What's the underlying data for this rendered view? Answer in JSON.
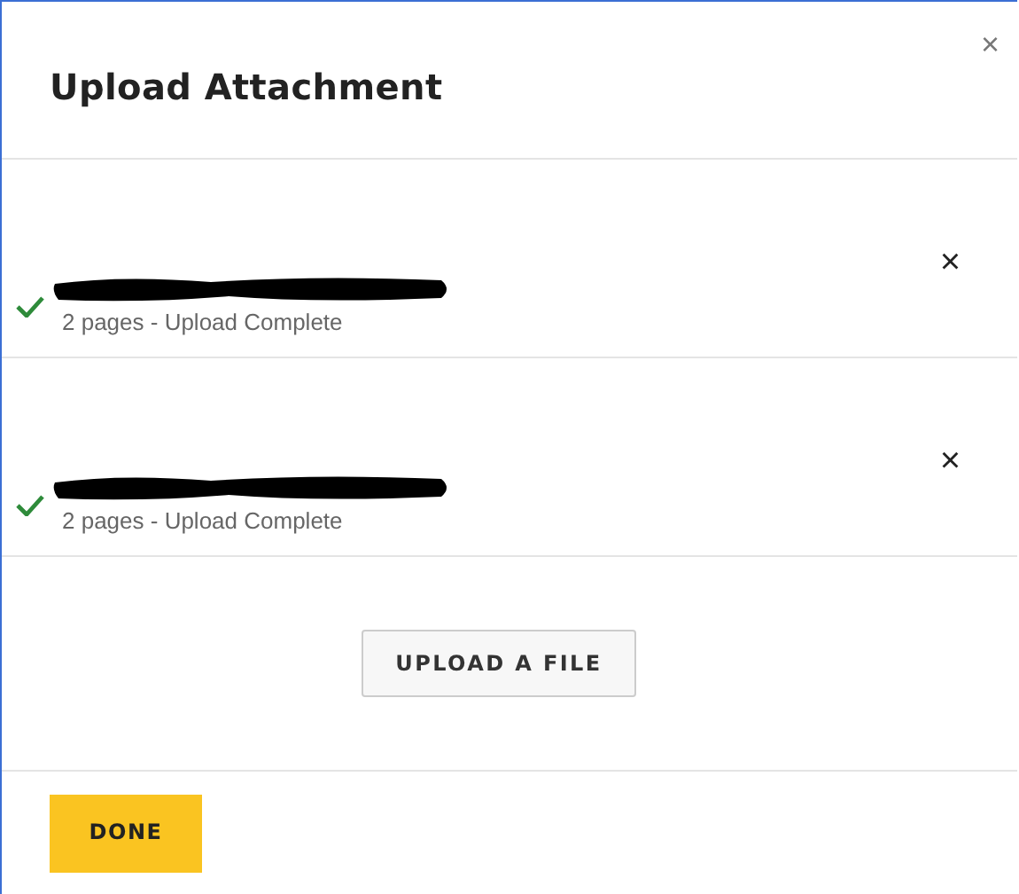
{
  "dialog": {
    "title": "Upload Attachment",
    "close": "×"
  },
  "files": [
    {
      "name_redacted": true,
      "complete": true,
      "status": "2 pages - Upload Complete",
      "remove": "×"
    },
    {
      "name_redacted": true,
      "complete": true,
      "status": "2 pages - Upload Complete",
      "remove": "×"
    }
  ],
  "upload_button": "UPLOAD A FILE",
  "done_button": "DONE"
}
